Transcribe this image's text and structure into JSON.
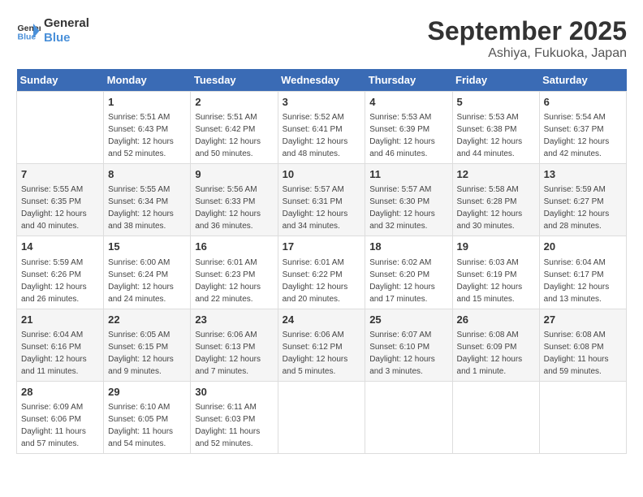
{
  "logo": {
    "text_general": "General",
    "text_blue": "Blue"
  },
  "title": "September 2025",
  "subtitle": "Ashiya, Fukuoka, Japan",
  "days_of_week": [
    "Sunday",
    "Monday",
    "Tuesday",
    "Wednesday",
    "Thursday",
    "Friday",
    "Saturday"
  ],
  "weeks": [
    [
      {
        "day": "",
        "info": ""
      },
      {
        "day": "1",
        "info": "Sunrise: 5:51 AM\nSunset: 6:43 PM\nDaylight: 12 hours\nand 52 minutes."
      },
      {
        "day": "2",
        "info": "Sunrise: 5:51 AM\nSunset: 6:42 PM\nDaylight: 12 hours\nand 50 minutes."
      },
      {
        "day": "3",
        "info": "Sunrise: 5:52 AM\nSunset: 6:41 PM\nDaylight: 12 hours\nand 48 minutes."
      },
      {
        "day": "4",
        "info": "Sunrise: 5:53 AM\nSunset: 6:39 PM\nDaylight: 12 hours\nand 46 minutes."
      },
      {
        "day": "5",
        "info": "Sunrise: 5:53 AM\nSunset: 6:38 PM\nDaylight: 12 hours\nand 44 minutes."
      },
      {
        "day": "6",
        "info": "Sunrise: 5:54 AM\nSunset: 6:37 PM\nDaylight: 12 hours\nand 42 minutes."
      }
    ],
    [
      {
        "day": "7",
        "info": "Sunrise: 5:55 AM\nSunset: 6:35 PM\nDaylight: 12 hours\nand 40 minutes."
      },
      {
        "day": "8",
        "info": "Sunrise: 5:55 AM\nSunset: 6:34 PM\nDaylight: 12 hours\nand 38 minutes."
      },
      {
        "day": "9",
        "info": "Sunrise: 5:56 AM\nSunset: 6:33 PM\nDaylight: 12 hours\nand 36 minutes."
      },
      {
        "day": "10",
        "info": "Sunrise: 5:57 AM\nSunset: 6:31 PM\nDaylight: 12 hours\nand 34 minutes."
      },
      {
        "day": "11",
        "info": "Sunrise: 5:57 AM\nSunset: 6:30 PM\nDaylight: 12 hours\nand 32 minutes."
      },
      {
        "day": "12",
        "info": "Sunrise: 5:58 AM\nSunset: 6:28 PM\nDaylight: 12 hours\nand 30 minutes."
      },
      {
        "day": "13",
        "info": "Sunrise: 5:59 AM\nSunset: 6:27 PM\nDaylight: 12 hours\nand 28 minutes."
      }
    ],
    [
      {
        "day": "14",
        "info": "Sunrise: 5:59 AM\nSunset: 6:26 PM\nDaylight: 12 hours\nand 26 minutes."
      },
      {
        "day": "15",
        "info": "Sunrise: 6:00 AM\nSunset: 6:24 PM\nDaylight: 12 hours\nand 24 minutes."
      },
      {
        "day": "16",
        "info": "Sunrise: 6:01 AM\nSunset: 6:23 PM\nDaylight: 12 hours\nand 22 minutes."
      },
      {
        "day": "17",
        "info": "Sunrise: 6:01 AM\nSunset: 6:22 PM\nDaylight: 12 hours\nand 20 minutes."
      },
      {
        "day": "18",
        "info": "Sunrise: 6:02 AM\nSunset: 6:20 PM\nDaylight: 12 hours\nand 17 minutes."
      },
      {
        "day": "19",
        "info": "Sunrise: 6:03 AM\nSunset: 6:19 PM\nDaylight: 12 hours\nand 15 minutes."
      },
      {
        "day": "20",
        "info": "Sunrise: 6:04 AM\nSunset: 6:17 PM\nDaylight: 12 hours\nand 13 minutes."
      }
    ],
    [
      {
        "day": "21",
        "info": "Sunrise: 6:04 AM\nSunset: 6:16 PM\nDaylight: 12 hours\nand 11 minutes."
      },
      {
        "day": "22",
        "info": "Sunrise: 6:05 AM\nSunset: 6:15 PM\nDaylight: 12 hours\nand 9 minutes."
      },
      {
        "day": "23",
        "info": "Sunrise: 6:06 AM\nSunset: 6:13 PM\nDaylight: 12 hours\nand 7 minutes."
      },
      {
        "day": "24",
        "info": "Sunrise: 6:06 AM\nSunset: 6:12 PM\nDaylight: 12 hours\nand 5 minutes."
      },
      {
        "day": "25",
        "info": "Sunrise: 6:07 AM\nSunset: 6:10 PM\nDaylight: 12 hours\nand 3 minutes."
      },
      {
        "day": "26",
        "info": "Sunrise: 6:08 AM\nSunset: 6:09 PM\nDaylight: 12 hours\nand 1 minute."
      },
      {
        "day": "27",
        "info": "Sunrise: 6:08 AM\nSunset: 6:08 PM\nDaylight: 11 hours\nand 59 minutes."
      }
    ],
    [
      {
        "day": "28",
        "info": "Sunrise: 6:09 AM\nSunset: 6:06 PM\nDaylight: 11 hours\nand 57 minutes."
      },
      {
        "day": "29",
        "info": "Sunrise: 6:10 AM\nSunset: 6:05 PM\nDaylight: 11 hours\nand 54 minutes."
      },
      {
        "day": "30",
        "info": "Sunrise: 6:11 AM\nSunset: 6:03 PM\nDaylight: 11 hours\nand 52 minutes."
      },
      {
        "day": "",
        "info": ""
      },
      {
        "day": "",
        "info": ""
      },
      {
        "day": "",
        "info": ""
      },
      {
        "day": "",
        "info": ""
      }
    ]
  ]
}
